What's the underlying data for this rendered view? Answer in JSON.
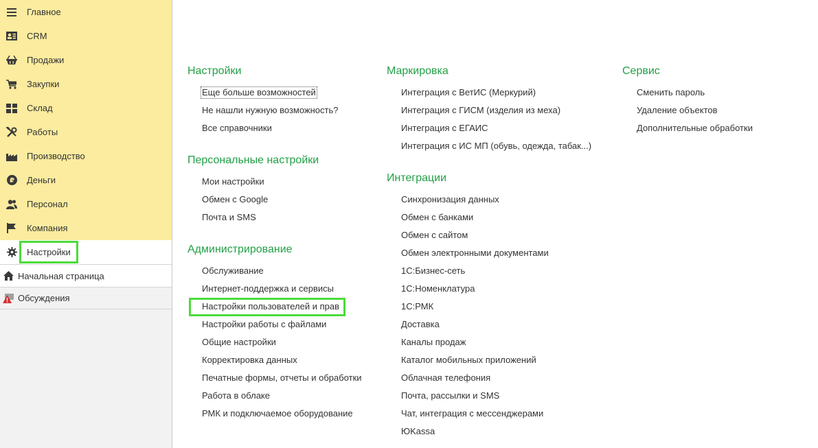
{
  "sidebar": {
    "sections": [
      {
        "label": "Главное",
        "icon": "menu-icon"
      },
      {
        "label": "CRM",
        "icon": "contact-card-icon"
      },
      {
        "label": "Продажи",
        "icon": "basket-icon"
      },
      {
        "label": "Закупки",
        "icon": "cart-icon"
      },
      {
        "label": "Склад",
        "icon": "warehouse-icon"
      },
      {
        "label": "Работы",
        "icon": "tools-icon"
      },
      {
        "label": "Производство",
        "icon": "factory-icon"
      },
      {
        "label": "Деньги",
        "icon": "ruble-coin-icon"
      },
      {
        "label": "Персонал",
        "icon": "people-icon"
      },
      {
        "label": "Компания",
        "icon": "flag-icon"
      },
      {
        "label": "Настройки",
        "icon": "gear-icon"
      }
    ],
    "commands": [
      {
        "label": "Начальная страница",
        "icon": "home-icon"
      },
      {
        "label": "Обсуждения",
        "icon": "discussion-alert-icon"
      }
    ]
  },
  "main": {
    "columns": [
      {
        "groups": [
          {
            "title": "Настройки",
            "links": [
              "Еще больше возможностей",
              "Не нашли нужную возможность?",
              "Все справочники"
            ]
          },
          {
            "title": "Персональные настройки",
            "links": [
              "Мои настройки",
              "Обмен с Google",
              "Почта и SMS"
            ]
          },
          {
            "title": "Администрирование",
            "links": [
              "Обслуживание",
              "Интернет-поддержка и сервисы",
              "Настройки пользователей и прав",
              "Настройки работы с файлами",
              "Общие настройки",
              "Корректировка данных",
              "Печатные формы, отчеты и обработки",
              "Работа в облаке",
              "РМК и подключаемое оборудование"
            ]
          }
        ]
      },
      {
        "groups": [
          {
            "title": "Маркировка",
            "links": [
              "Интеграция с ВетИС (Меркурий)",
              "Интеграция с ГИСМ (изделия из меха)",
              "Интеграция с ЕГАИС",
              "Интеграция с ИС МП (обувь, одежда, табак...)"
            ]
          },
          {
            "title": "Интеграции",
            "links": [
              "Синхронизация данных",
              "Обмен с банками",
              "Обмен с сайтом",
              "Обмен электронными документами",
              "1С:Бизнес-сеть",
              "1С:Номенклатура",
              "1С:РМК",
              "Доставка",
              "Каналы продаж",
              "Каталог мобильных приложений",
              "Облачная телефония",
              "Почта, рассылки и SMS",
              "Чат, интеграция с мессенджерами",
              "ЮKassa"
            ]
          }
        ]
      },
      {
        "groups": [
          {
            "title": "Сервис",
            "links": [
              "Сменить пароль",
              "Удаление объектов",
              "Дополнительные обработки"
            ]
          }
        ]
      }
    ]
  },
  "colors": {
    "sidebar_bg": "#fbec9f",
    "group_title": "#21a046",
    "highlight_frame": "#4cdb3a"
  }
}
